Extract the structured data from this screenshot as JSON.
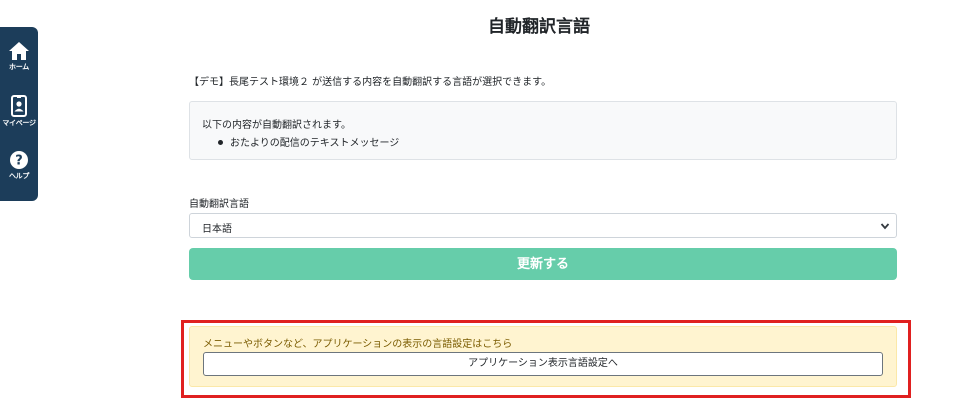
{
  "sidebar": {
    "items": [
      {
        "label": "ホーム",
        "icon": "home-icon"
      },
      {
        "label": "マイページ",
        "icon": "id-badge-icon"
      },
      {
        "label": "ヘルプ",
        "icon": "help-icon"
      }
    ],
    "background": "#1c3d5a"
  },
  "main": {
    "title": "自動翻訳言語",
    "intro": "【デモ】長尾テスト環境２ が送信する内容を自動翻訳する言語が選択できます。",
    "info": {
      "heading": "以下の内容が自動翻訳されます。",
      "items": [
        "おたよりの配信のテキストメッセージ"
      ]
    },
    "language_select": {
      "label": "自動翻訳言語",
      "value": "日本語"
    },
    "update_button": "更新する",
    "ui_language": {
      "message": "メニューやボタンなど、アプリケーションの表示の言語設定はこちら",
      "button": "アプリケーション表示言語設定へ"
    }
  },
  "colors": {
    "accent": "#66cdaa",
    "highlight": "#e02020",
    "warning_bg": "#fff4d0"
  }
}
